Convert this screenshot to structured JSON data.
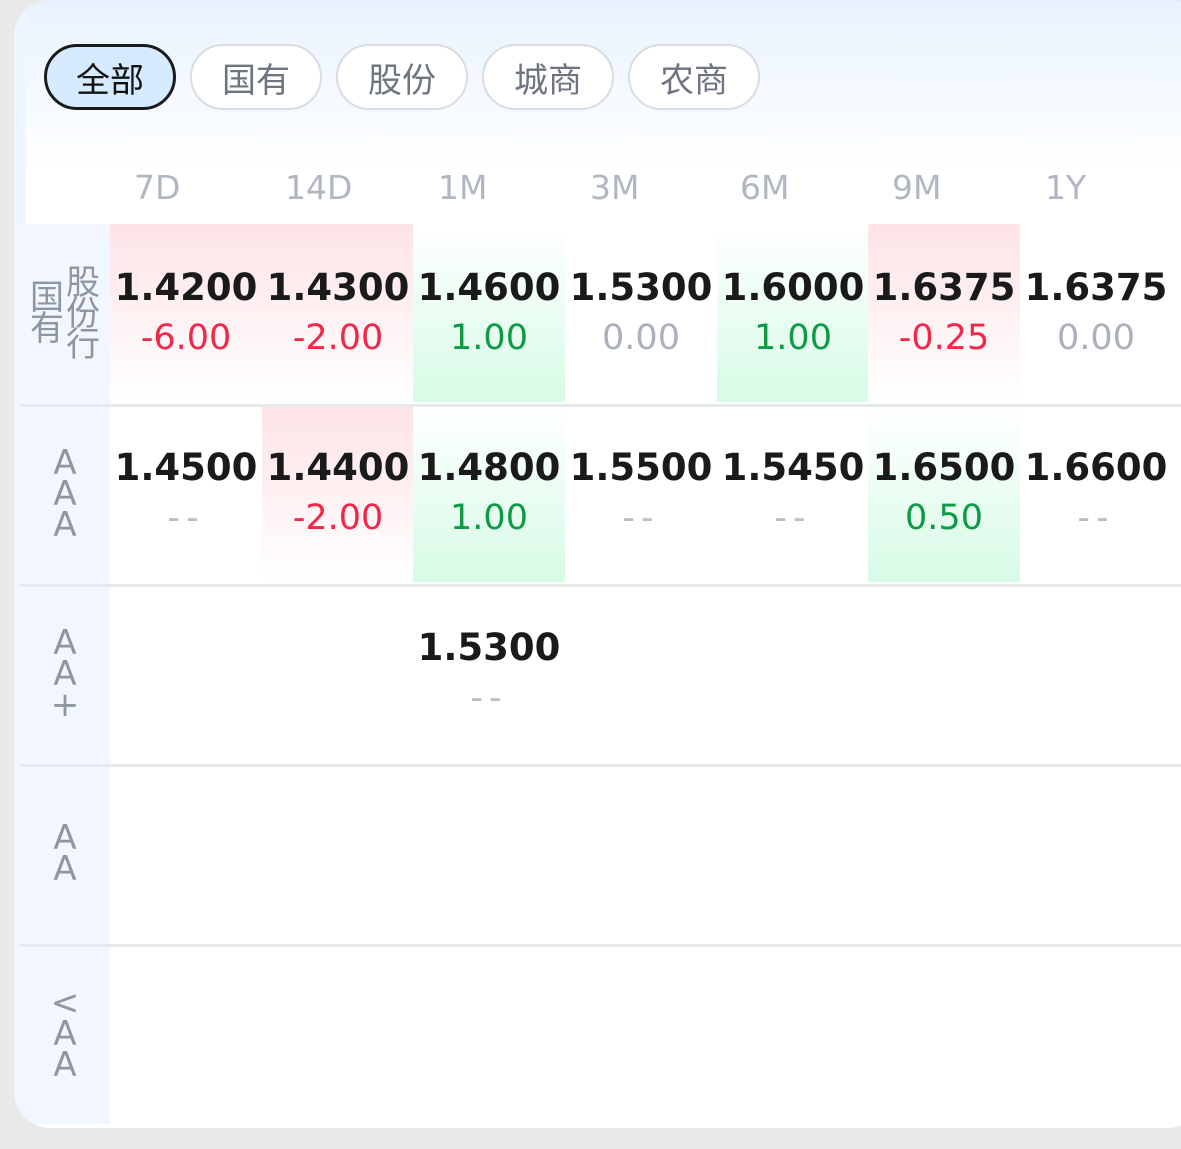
{
  "filters": [
    {
      "label": "全部",
      "active": true
    },
    {
      "label": "国有",
      "active": false
    },
    {
      "label": "股份",
      "active": false
    },
    {
      "label": "城商",
      "active": false
    },
    {
      "label": "农商",
      "active": false
    }
  ],
  "columns": [
    "7D",
    "14D",
    "1M",
    "3M",
    "6M",
    "9M",
    "1Y"
  ],
  "rows": [
    {
      "label": "国有股份行",
      "cells": [
        {
          "value": "1.4200",
          "change": "-6.00",
          "trend": "neg"
        },
        {
          "value": "1.4300",
          "change": "-2.00",
          "trend": "neg"
        },
        {
          "value": "1.4600",
          "change": "1.00",
          "trend": "pos"
        },
        {
          "value": "1.5300",
          "change": "0.00",
          "trend": "zero"
        },
        {
          "value": "1.6000",
          "change": "1.00",
          "trend": "pos"
        },
        {
          "value": "1.6375",
          "change": "-0.25",
          "trend": "neg"
        },
        {
          "value": "1.6375",
          "change": "0.00",
          "trend": "zero"
        }
      ]
    },
    {
      "label": "AAA",
      "cells": [
        {
          "value": "1.4500",
          "change": "--",
          "trend": "dash"
        },
        {
          "value": "1.4400",
          "change": "-2.00",
          "trend": "neg"
        },
        {
          "value": "1.4800",
          "change": "1.00",
          "trend": "pos"
        },
        {
          "value": "1.5500",
          "change": "--",
          "trend": "dash"
        },
        {
          "value": "1.5450",
          "change": "--",
          "trend": "dash"
        },
        {
          "value": "1.6500",
          "change": "0.50",
          "trend": "pos"
        },
        {
          "value": "1.6600",
          "change": "--",
          "trend": "dash"
        }
      ]
    },
    {
      "label": "AA+",
      "cells": [
        null,
        null,
        {
          "value": "1.5300",
          "change": "--",
          "trend": "dash"
        },
        null,
        null,
        null,
        null
      ]
    },
    {
      "label": "AA",
      "cells": [
        null,
        null,
        null,
        null,
        null,
        null,
        null
      ]
    },
    {
      "label": "<AA",
      "cells": [
        null,
        null,
        null,
        null,
        null,
        null,
        null
      ]
    }
  ],
  "colors": {
    "up": "#0f9b46",
    "down": "#f0284a",
    "flat": "#aab1bb",
    "activeChip": "#d6ebff"
  }
}
